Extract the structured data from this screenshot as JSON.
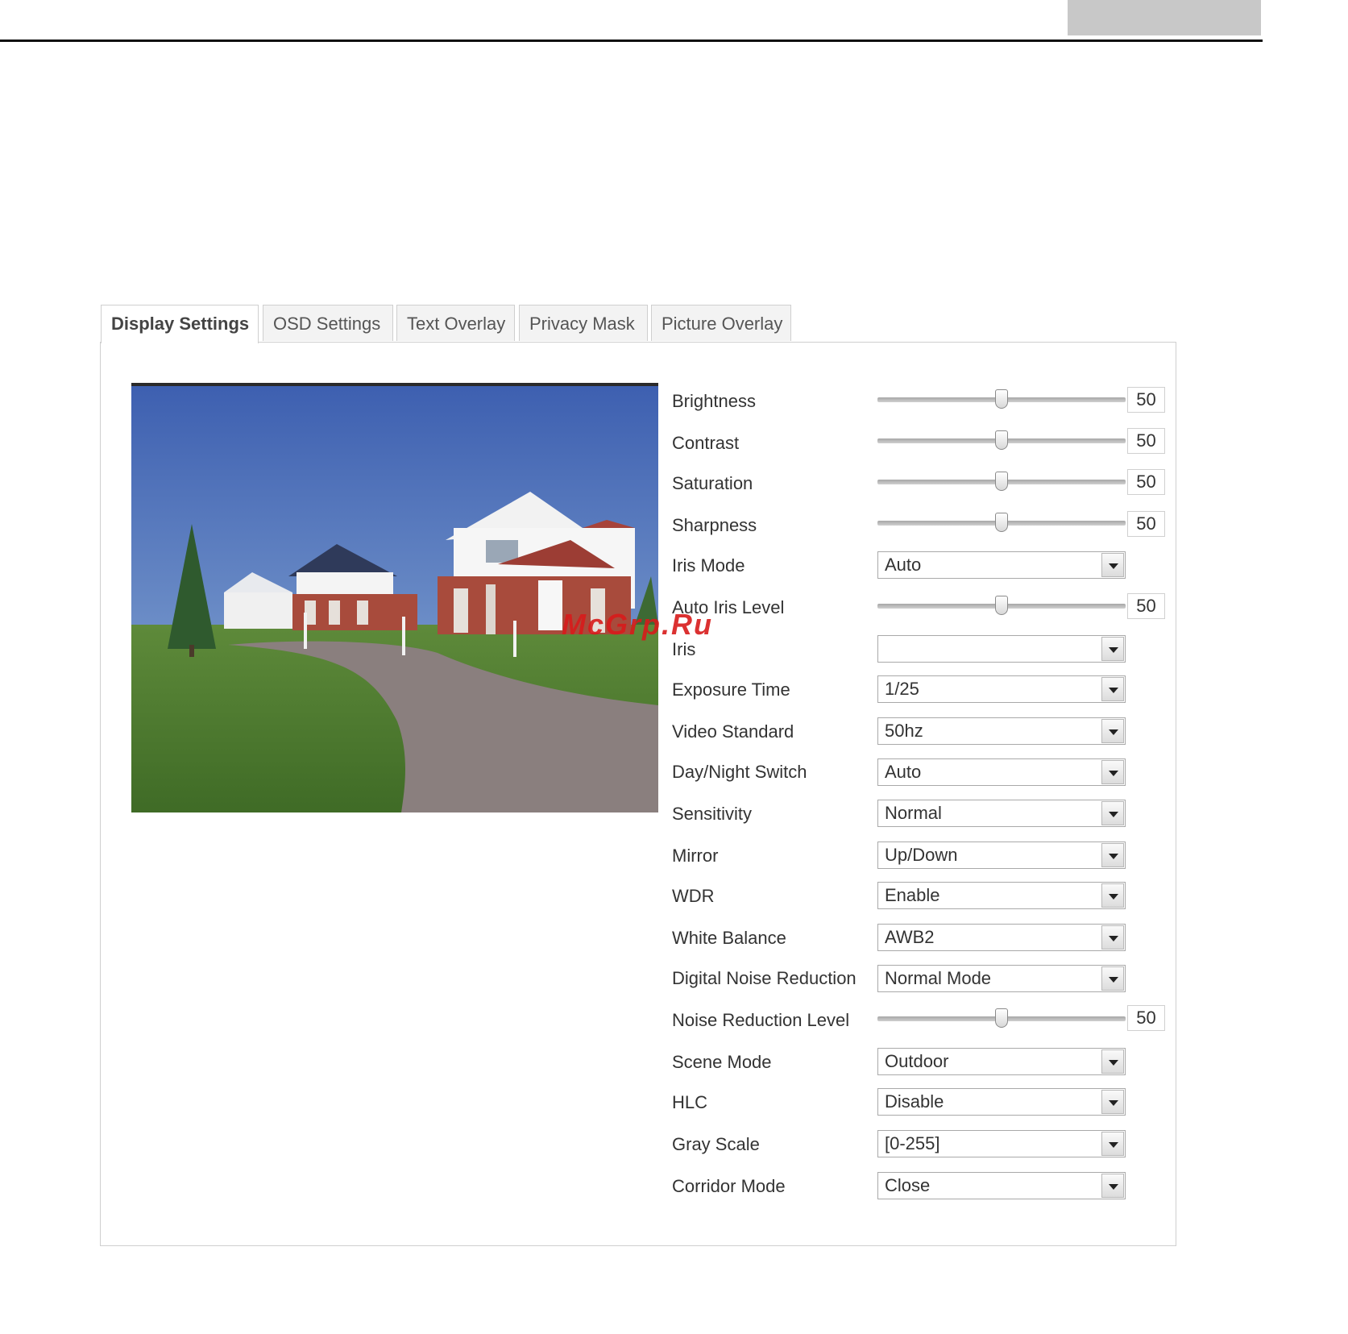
{
  "tabs": [
    {
      "label": "Display Settings",
      "active": true
    },
    {
      "label": "OSD Settings",
      "active": false
    },
    {
      "label": "Text Overlay",
      "active": false
    },
    {
      "label": "Privacy Mask",
      "active": false
    },
    {
      "label": "Picture Overlay",
      "active": false
    }
  ],
  "settings": {
    "brightness": {
      "label": "Brightness",
      "value": "50",
      "level": 50
    },
    "contrast": {
      "label": "Contrast",
      "value": "50",
      "level": 50
    },
    "saturation": {
      "label": "Saturation",
      "value": "50",
      "level": 50
    },
    "sharpness": {
      "label": "Sharpness",
      "value": "50",
      "level": 50
    },
    "iris_mode": {
      "label": "Iris Mode",
      "selected": "Auto"
    },
    "auto_iris_level": {
      "label": "Auto Iris Level",
      "value": "50",
      "level": 50
    },
    "iris": {
      "label": "Iris",
      "selected": ""
    },
    "exposure_time": {
      "label": "Exposure Time",
      "selected": "1/25"
    },
    "video_standard": {
      "label": "Video Standard",
      "selected": "50hz"
    },
    "day_night_switch": {
      "label": "Day/Night Switch",
      "selected": "Auto"
    },
    "sensitivity": {
      "label": "Sensitivity",
      "selected": "Normal"
    },
    "mirror": {
      "label": "Mirror",
      "selected": "Up/Down"
    },
    "wdr": {
      "label": "WDR",
      "selected": "Enable"
    },
    "white_balance": {
      "label": "White Balance",
      "selected": "AWB2"
    },
    "digital_noise_reduction": {
      "label": "Digital Noise Reduction",
      "selected": "Normal Mode"
    },
    "noise_reduction_level": {
      "label": "Noise Reduction Level",
      "value": "50",
      "level": 50
    },
    "scene_mode": {
      "label": "Scene Mode",
      "selected": "Outdoor"
    },
    "hlc": {
      "label": "HLC",
      "selected": "Disable"
    },
    "gray_scale": {
      "label": "Gray Scale",
      "selected": "[0-255]"
    },
    "corridor_mode": {
      "label": "Corridor Mode",
      "selected": "Close"
    }
  },
  "watermark": "McGrp.Ru",
  "colors": {
    "accent_watermark": "#d81b1b",
    "border": "#cfcfcf",
    "tab_inactive_bg": "#f3f3f3"
  }
}
